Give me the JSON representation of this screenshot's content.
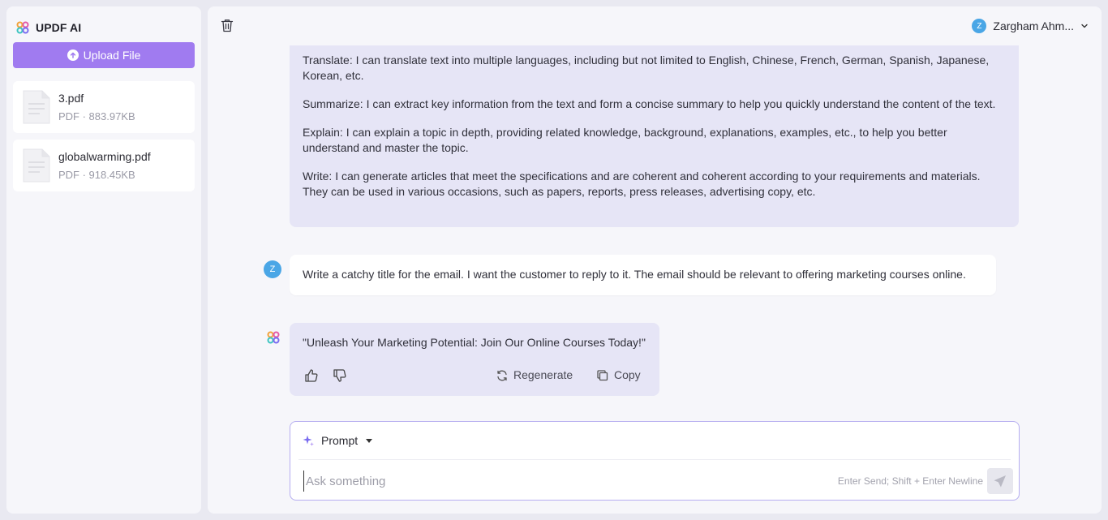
{
  "sidebar": {
    "brand": "UPDF AI",
    "upload_label": "Upload File",
    "files": [
      {
        "name": "3.pdf",
        "meta": "PDF · 883.97KB"
      },
      {
        "name": "globalwarming.pdf",
        "meta": "PDF · 918.45KB"
      }
    ]
  },
  "header": {
    "user_name": "Zargham Ahm...",
    "user_initial": "Z"
  },
  "chat": {
    "intro": [
      "Translate: I can translate text into multiple languages, including but not limited to English, Chinese, French, German, Spanish, Japanese, Korean, etc.",
      "Summarize: I can extract key information from the text and form a concise summary to help you quickly understand the content of the text.",
      "Explain: I can explain a topic in depth, providing related knowledge, background, explanations, examples, etc., to help you better understand and master the topic.",
      "Write: I can generate articles that meet the specifications and are coherent and coherent according to your requirements and materials. They can be used in various occasions, such as papers, reports, press releases, advertising copy, etc."
    ],
    "user_message": "Write a catchy title for the email. I want the customer to reply to it. The email should be relevant to offering marketing courses online.",
    "ai_message": "\"Unleash Your Marketing Potential: Join Our Online Courses Today!\"",
    "regenerate_label": "Regenerate",
    "copy_label": "Copy"
  },
  "composer": {
    "prompt_label": "Prompt",
    "placeholder": "Ask something",
    "hint": "Enter Send; Shift + Enter Newline"
  },
  "colors": {
    "accent": "#a07bf0",
    "ai_bubble": "#e6e5f6",
    "avatar": "#4aa6e6"
  }
}
